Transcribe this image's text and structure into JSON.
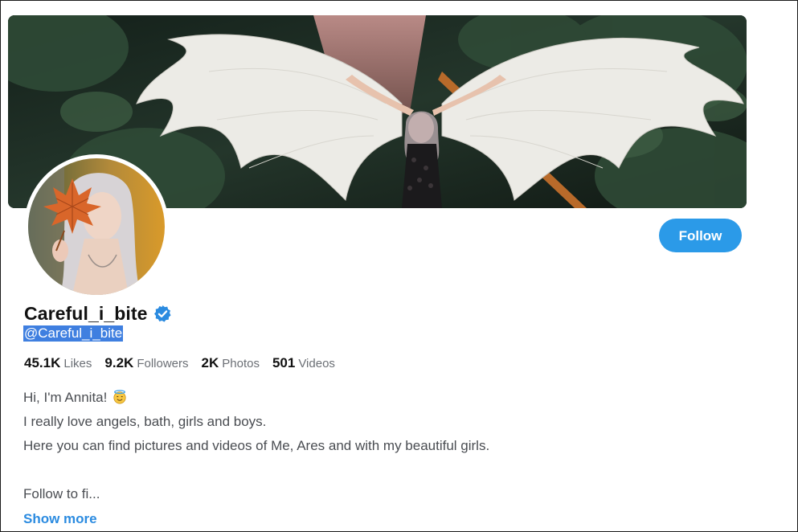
{
  "profile": {
    "display_name": "Careful_i_bite",
    "verified_icon": "verified-check-icon",
    "handle": "@Careful_i_bite",
    "follow_label": "Follow"
  },
  "stats": [
    {
      "value": "45.1K",
      "label": "Likes"
    },
    {
      "value": "9.2K",
      "label": "Followers"
    },
    {
      "value": "2K",
      "label": "Photos"
    },
    {
      "value": "501",
      "label": "Videos"
    }
  ],
  "bio": {
    "line1": "Hi, I'm Annita!",
    "line1_emoji": "smiling-face-with-halo-icon",
    "line2": "I really love angels, bath, girls and boys.",
    "line3": "Here you can find pictures and videos of Me, Ares and with my beautiful girls.",
    "line4": "Follow to fi..."
  },
  "show_more_label": "Show more",
  "colors": {
    "accent": "#2b9ae8",
    "verified": "#2b8be0",
    "selection": "#3f7fe0",
    "text_primary": "#111111",
    "text_secondary": "#6b6f75"
  }
}
